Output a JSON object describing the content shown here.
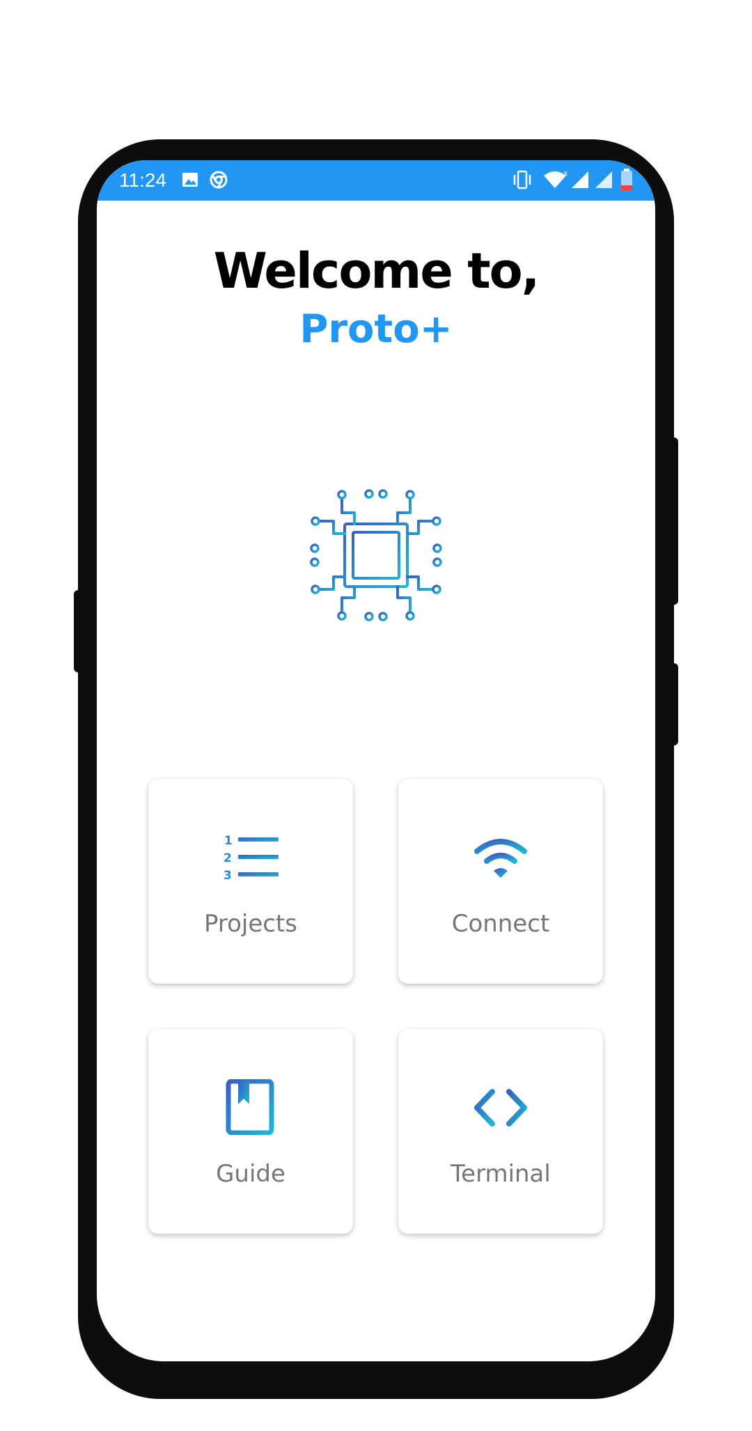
{
  "status_bar": {
    "time": "11:24",
    "icons": [
      "image-icon",
      "chrome-icon",
      "vibrate-icon",
      "wifi-icon",
      "signal-icon",
      "signal-icon",
      "battery-icon"
    ],
    "color": "#2196f3"
  },
  "header": {
    "welcome": "Welcome to,",
    "app_name": "Proto+"
  },
  "illustration": {
    "icon": "circuit-chip-icon"
  },
  "menu": {
    "projects": {
      "label": "Projects",
      "icon": "numbered-list-icon"
    },
    "connect": {
      "label": "Connect",
      "icon": "wifi-icon"
    },
    "guide": {
      "label": "Guide",
      "icon": "book-icon"
    },
    "terminal": {
      "label": "Terminal",
      "icon": "code-icon"
    }
  },
  "colors": {
    "accent": "#2196f3",
    "gradient_start": "#3b5fc0",
    "gradient_end": "#1ab8d6",
    "label_gray": "#757575"
  }
}
